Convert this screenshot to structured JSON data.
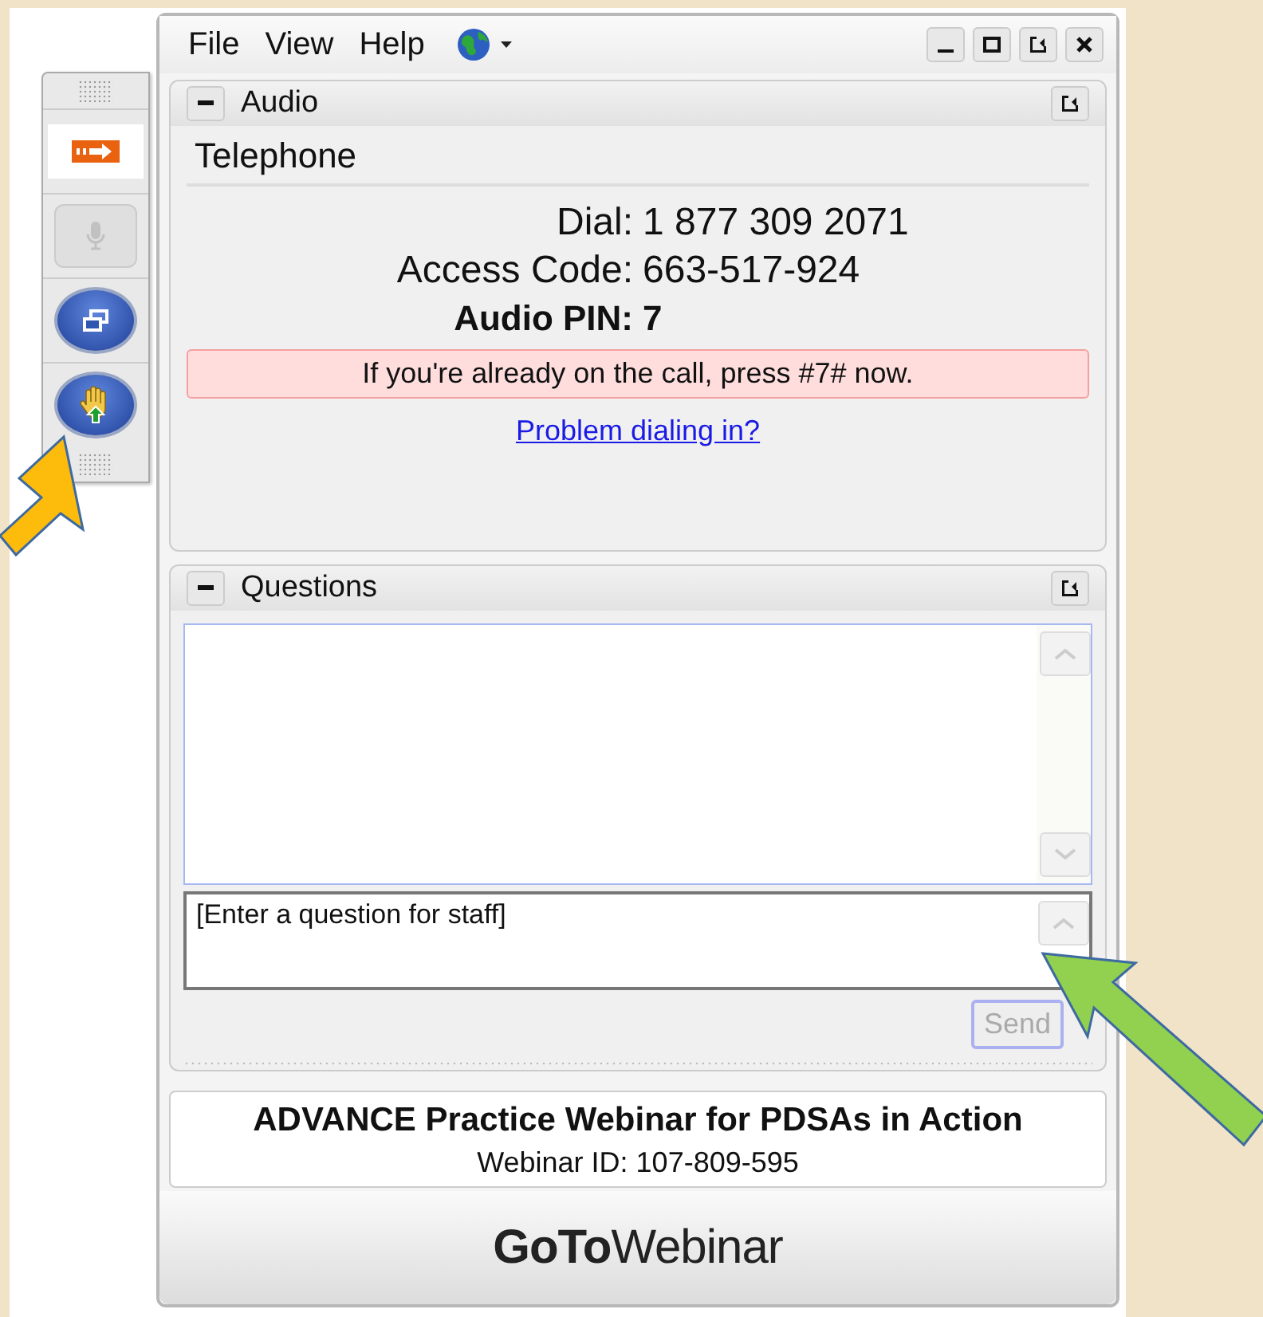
{
  "menu": [
    {
      "label": "File"
    },
    {
      "label": "View"
    },
    {
      "label": "Help"
    }
  ],
  "toolbar": [
    {
      "kind": "arrow",
      "disabled": false
    },
    {
      "kind": "mic",
      "disabled": true
    },
    {
      "kind": "window",
      "disabled": false
    },
    {
      "kind": "hand",
      "disabled": false
    }
  ],
  "audio": {
    "title": "Audio",
    "mode": "Telephone",
    "lines": [
      {
        "label": "Dial:",
        "value": "1 877 309 2071",
        "bold": false
      },
      {
        "label": "Access Code:",
        "value": "663-517-924",
        "bold": false
      },
      {
        "label": "Audio PIN:",
        "value": "7",
        "bold": true
      }
    ],
    "notice": "If you're already on the call, press #7# now.",
    "help_link": "Problem dialing in?"
  },
  "questions": {
    "title": "Questions",
    "placeholder": "[Enter a question for staff]",
    "send": {
      "label": "Send",
      "disabled": true
    }
  },
  "footer": {
    "webinar_title": "ADVANCE Practice Webinar for PDSAs in Action",
    "webinar_id": "Webinar ID: 107-809-595"
  },
  "logo": "**GoTo**Webinar"
}
